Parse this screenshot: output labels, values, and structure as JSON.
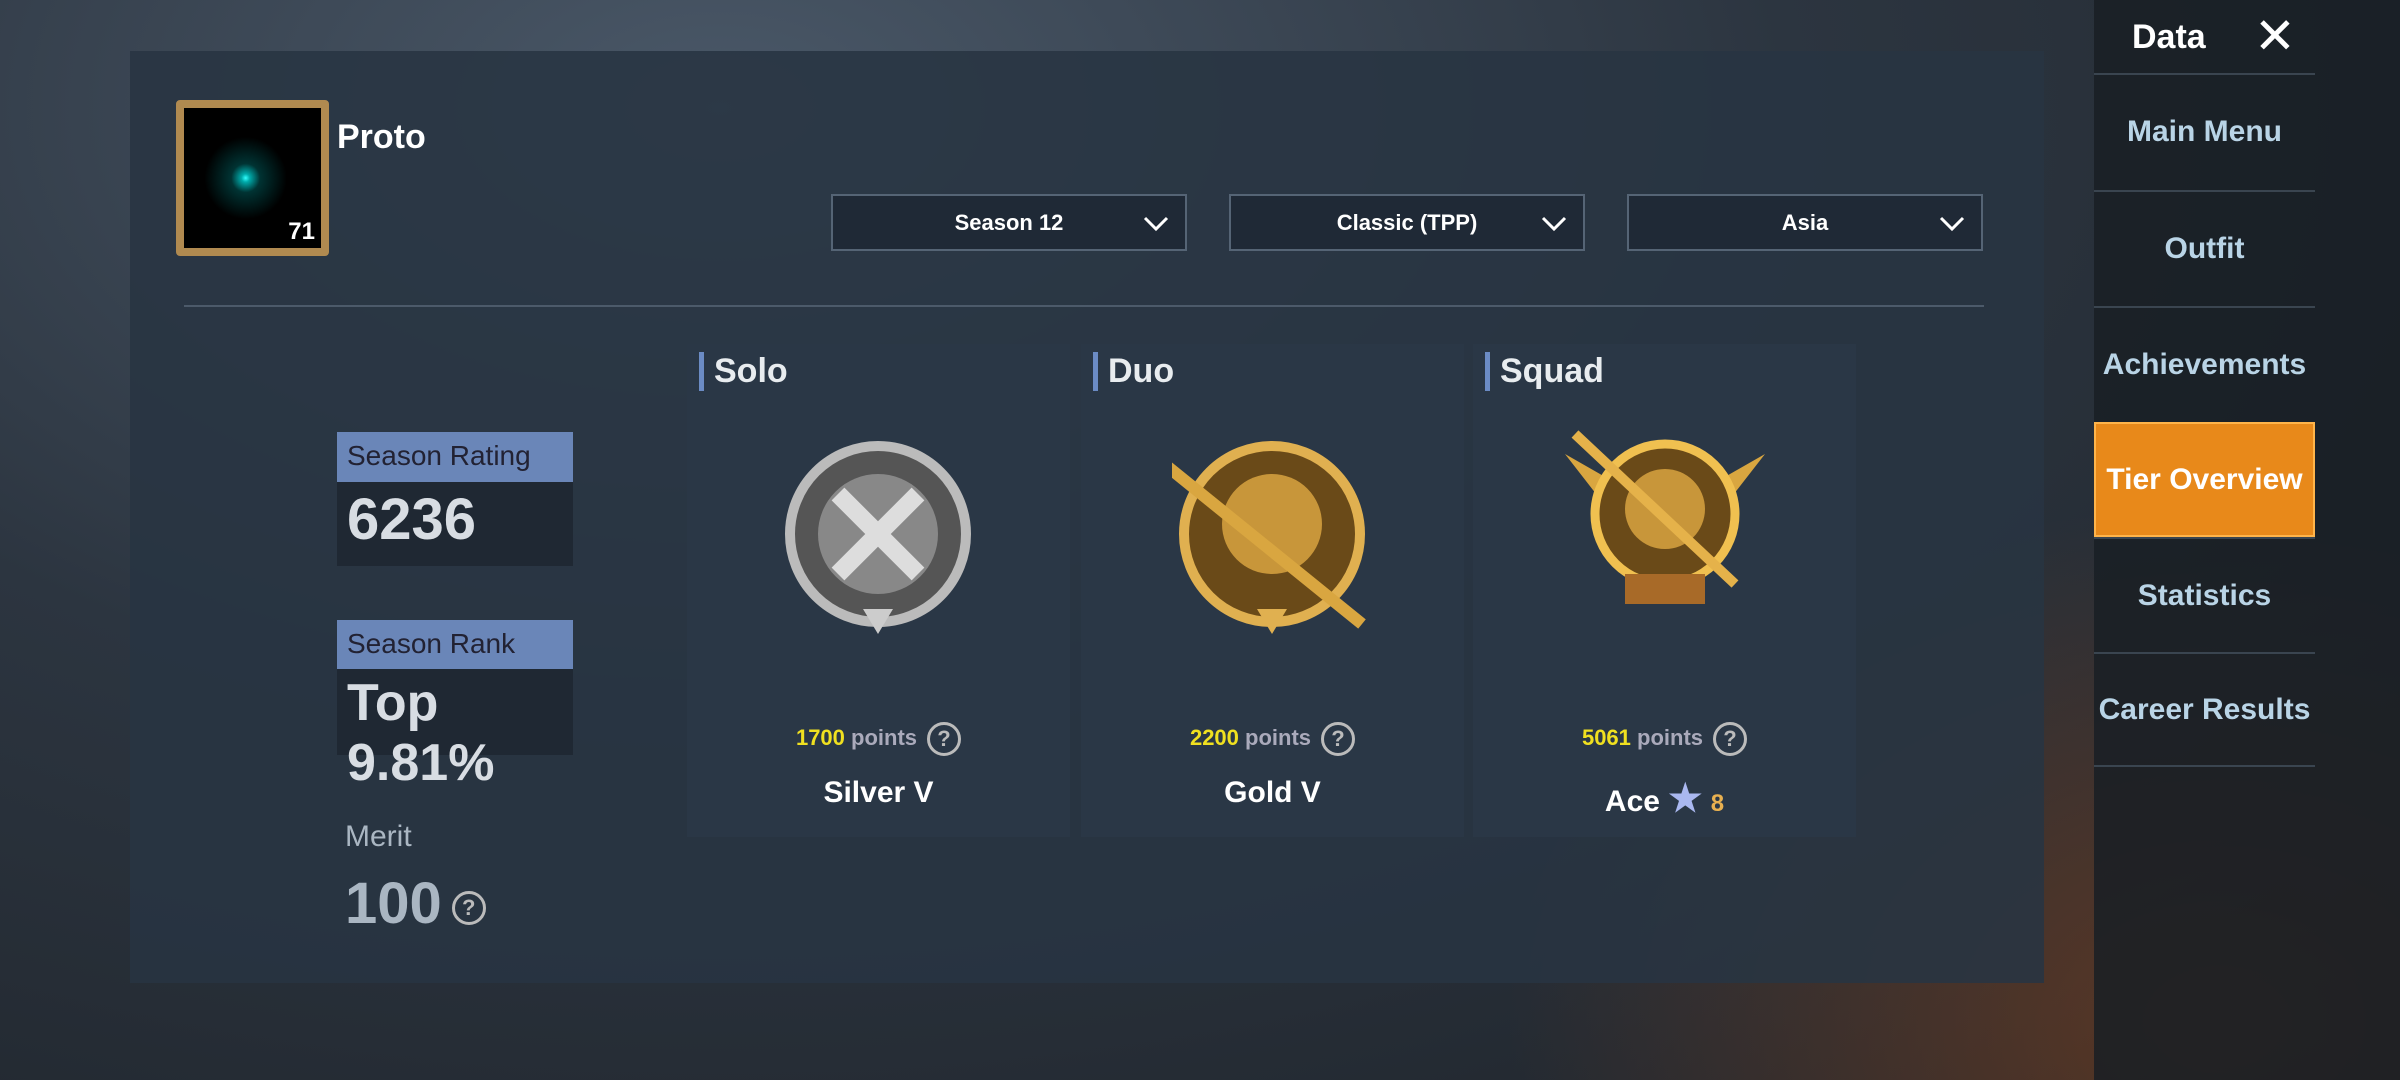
{
  "player": {
    "name": "Proto",
    "level": "71"
  },
  "filters": {
    "season": "Season 12",
    "mode": "Classic (TPP)",
    "region": "Asia"
  },
  "stats": {
    "rating_label": "Season Rating",
    "rating": "6236",
    "rank_label": "Season Rank",
    "rank": "Top 9.81%",
    "merit_label": "Merit",
    "merit": "100"
  },
  "cards": [
    {
      "title": "Solo",
      "points": "1700",
      "points_label": "points",
      "tier": "Silver V"
    },
    {
      "title": "Duo",
      "points": "2200",
      "points_label": "points",
      "tier": "Gold V"
    },
    {
      "title": "Squad",
      "points": "5061",
      "points_label": "points",
      "tier": "Ace",
      "stars": "8"
    }
  ],
  "sidebar": {
    "title": "Data",
    "items": [
      "Main Menu",
      "Outfit",
      "Achievements",
      "Tier Overview",
      "Statistics",
      "Career Results"
    ],
    "active": "Tier Overview"
  }
}
